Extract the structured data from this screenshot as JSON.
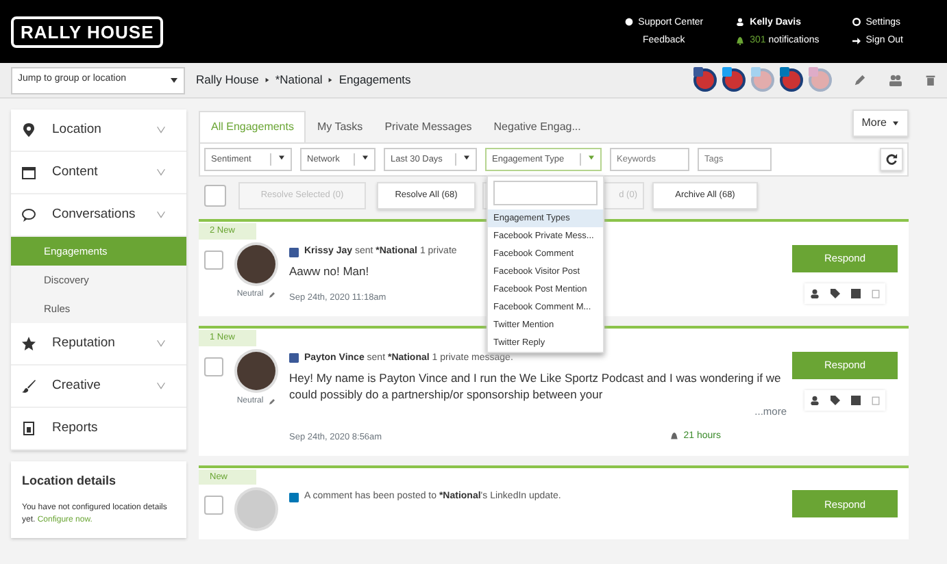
{
  "header": {
    "logo": "RALLY HOUSE",
    "support_center": "Support Center",
    "feedback": "Feedback",
    "user": "Kelly Davis",
    "notification_count": "301",
    "notification_label": "notifications",
    "settings": "Settings",
    "sign_out": "Sign Out"
  },
  "toolbar": {
    "location_select": "Jump to group or location",
    "breadcrumb": [
      "Rally House",
      "*National",
      "Engagements"
    ],
    "profiles": [
      {
        "kind": "facebook",
        "faded": false
      },
      {
        "kind": "twitter",
        "faded": false
      },
      {
        "kind": "twitter",
        "faded": true
      },
      {
        "kind": "linkedin",
        "faded": false
      },
      {
        "kind": "instagram",
        "faded": true
      }
    ]
  },
  "sidebar": {
    "items": [
      {
        "label": "Location",
        "kind": "pin",
        "expandable": true
      },
      {
        "label": "Content",
        "kind": "calendar",
        "expandable": true
      },
      {
        "label": "Conversations",
        "kind": "chat",
        "expandable": true,
        "expanded": true,
        "children": [
          {
            "label": "Engagements",
            "selected": true
          },
          {
            "label": "Discovery",
            "selected": false
          },
          {
            "label": "Rules",
            "selected": false
          }
        ]
      },
      {
        "label": "Reputation",
        "kind": "star",
        "expandable": true
      },
      {
        "label": "Creative",
        "kind": "brush",
        "expandable": true
      },
      {
        "label": "Reports",
        "kind": "report",
        "expandable": false
      }
    ],
    "location_details": {
      "title": "Location details",
      "text": "You have not configured location details yet.",
      "link": "Configure now."
    }
  },
  "tabs": [
    {
      "label": "All Engagements",
      "selected": true
    },
    {
      "label": "My Tasks",
      "selected": false
    },
    {
      "label": "Private Messages",
      "selected": false
    },
    {
      "label": "Negative Engag...",
      "selected": false
    }
  ],
  "more_button": "More",
  "filters": [
    {
      "kind": "select",
      "label": "Sentiment",
      "active": false
    },
    {
      "kind": "select",
      "label": "Network",
      "active": false
    },
    {
      "kind": "select",
      "label": "Last 30 Days",
      "active": false
    },
    {
      "kind": "select",
      "label": "Engagement Type",
      "active": true
    },
    {
      "kind": "input",
      "placeholder": "Keywords"
    },
    {
      "kind": "input",
      "placeholder": "Tags"
    }
  ],
  "select_all_checked": false,
  "actions": [
    {
      "label": "Resolve Selected (0)",
      "disabled": true
    },
    {
      "label": "Resolve All (68)",
      "disabled": false
    },
    {
      "label": "d (0)",
      "disabled": true
    },
    {
      "label": "Archive All (68)",
      "disabled": false
    }
  ],
  "dropdown": {
    "items": [
      {
        "label": "Engagement Types",
        "selected": true
      },
      {
        "label": "Facebook Private Mess...",
        "selected": false
      },
      {
        "label": "Facebook Comment",
        "selected": false
      },
      {
        "label": "Facebook Visitor Post",
        "selected": false
      },
      {
        "label": "Facebook Post Mention",
        "selected": false
      },
      {
        "label": "Facebook Comment M...",
        "selected": false
      },
      {
        "label": "Twitter Mention",
        "selected": false
      },
      {
        "label": "Twitter Reply",
        "selected": false
      }
    ]
  },
  "engagements": [
    {
      "badge": "2 New",
      "kind": "facebook",
      "photo": true,
      "checked": false,
      "sentiment": "Neutral",
      "header": [
        {
          "text": "Krissy Jay",
          "bold": true
        },
        {
          "text": " sent ",
          "bold": false
        },
        {
          "text": "*National",
          "bold": true
        },
        {
          "text": " 1 private",
          "bold": false
        }
      ],
      "message": "Aaww no! Man!",
      "date": "Sep 24th, 2020 11:18am",
      "respond": "Respond"
    },
    {
      "badge": "1 New",
      "kind": "facebook",
      "photo": true,
      "checked": false,
      "sentiment": "Neutral",
      "header": [
        {
          "text": "Payton Vince",
          "bold": true
        },
        {
          "text": " sent ",
          "bold": false
        },
        {
          "text": "*National",
          "bold": true
        },
        {
          "text": " 1 private message.",
          "bold": false
        }
      ],
      "message": "Hey! My name is Payton Vince and I run the We Like Sportz Podcast and I was wondering if we could possibly do a partnership/or sponsorship between your",
      "more": "...more",
      "date": "Sep 24th, 2020 8:56am",
      "timer": "21 hours",
      "respond": "Respond"
    },
    {
      "badge": "New",
      "kind": "linkedin",
      "photo": false,
      "checked": false,
      "header": [
        {
          "text": "A comment has been posted to ",
          "bold": false
        },
        {
          "text": "*National",
          "bold": true
        },
        {
          "text": "'s LinkedIn update.",
          "bold": false
        }
      ],
      "respond": "Respond"
    }
  ]
}
